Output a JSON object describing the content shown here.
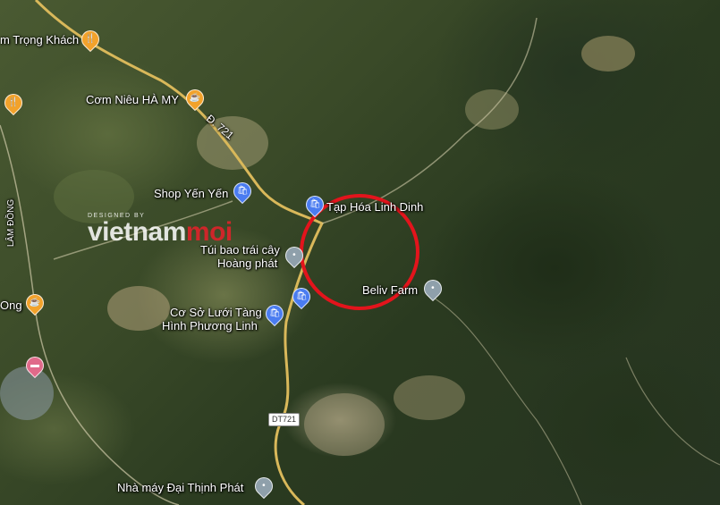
{
  "map": {
    "labels": [
      {
        "text": "m Trọng Khách"
      },
      {
        "text": "Cơm Niêu HÀ MY"
      },
      {
        "text": "Đ. 721"
      },
      {
        "text": "LÂM ĐỒNG"
      },
      {
        "text": "Shop Yến Yến"
      },
      {
        "text": "Tạp Hóa Linh Dinh"
      },
      {
        "text": "Túi bao trái cây"
      },
      {
        "text": "Hoàng phát"
      },
      {
        "text": "Beliv Farm"
      },
      {
        "text": "Ong"
      },
      {
        "text": "Cơ Sở Lưới Tàng"
      },
      {
        "text": "Hình Phương Linh"
      },
      {
        "text": "Nhà máy Đại Thịnh Phát"
      }
    ],
    "road_shield": "DT721",
    "icons": {
      "restaurant": "fork-knife-icon",
      "cafe": "cup-icon",
      "shopping": "shopping-bag-icon",
      "place": "location-pin-icon",
      "hotel": "bed-icon"
    },
    "highlight_color": "#e3141c",
    "road_color": "#d9b85a"
  },
  "watermark": {
    "small": "DESIGNED BY",
    "big_main": "vietnam",
    "big_accent": "moi"
  }
}
